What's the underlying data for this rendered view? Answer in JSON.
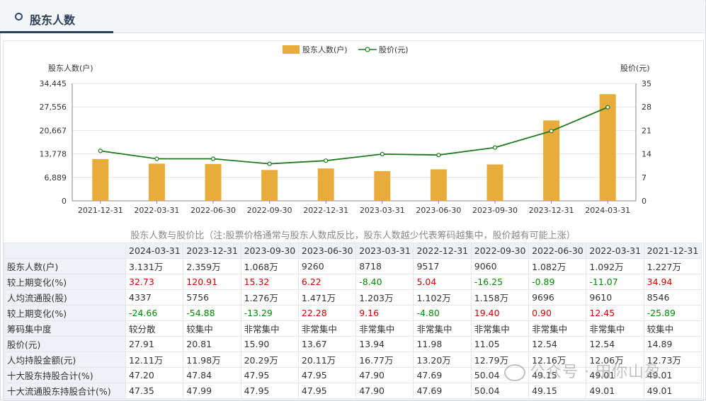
{
  "header": {
    "title": "股东人数"
  },
  "chart_data": {
    "type": "bar+line",
    "legend": [
      {
        "name": "股东人数(户)",
        "color": "#e9ac3a",
        "kind": "bar"
      },
      {
        "name": "股价(元)",
        "color": "#1e7a1e",
        "kind": "line"
      }
    ],
    "left_axis_title": "股东人数(户)",
    "right_axis_title": "股价(元)",
    "left_ticks": [
      "0",
      "6,889",
      "13,778",
      "20,667",
      "27,556",
      "34,445"
    ],
    "right_ticks": [
      "0",
      "7",
      "14",
      "21",
      "28",
      "35"
    ],
    "left_max": 34445,
    "right_max": 35,
    "categories": [
      "2021-12-31",
      "2022-03-31",
      "2022-06-30",
      "2022-09-30",
      "2022-12-31",
      "2023-03-31",
      "2023-06-30",
      "2023-09-30",
      "2023-12-31",
      "2024-03-31"
    ],
    "series": [
      {
        "name": "股东人数(户)",
        "values": [
          12270,
          10920,
          10820,
          9060,
          9517,
          8718,
          9260,
          10680,
          23590,
          31310
        ]
      },
      {
        "name": "股价(元)",
        "values": [
          14.89,
          12.54,
          12.54,
          11.05,
          11.98,
          13.94,
          13.67,
          15.9,
          20.81,
          27.91
        ]
      }
    ],
    "grid": true,
    "legend_position": "top-center"
  },
  "note": "股东人数与股价比（注:股票价格通常与股东人数成反比，股东人数越少代表筹码越集中，股价越有可能上涨）",
  "table": {
    "columns": [
      "2024-03-31",
      "2023-12-31",
      "2023-09-30",
      "2023-06-30",
      "2023-03-31",
      "2022-12-31",
      "2022-09-30",
      "2022-06-30",
      "2022-03-31",
      "2021-12-31"
    ],
    "rows": [
      {
        "label": "股东人数(户)",
        "cells": [
          "3.131万",
          "2.359万",
          "1.068万",
          "9260",
          "8718",
          "9517",
          "9060",
          "1.082万",
          "1.092万",
          "1.227万"
        ]
      },
      {
        "label": "较上期变化(%)",
        "cells": [
          "32.73",
          "120.91",
          "15.32",
          "6.22",
          "-8.40",
          "5.04",
          "-16.25",
          "-0.89",
          "-11.07",
          "34.94"
        ],
        "colored": true
      },
      {
        "label": "人均流通股(股)",
        "cells": [
          "4337",
          "5756",
          "1.276万",
          "1.471万",
          "1.203万",
          "1.102万",
          "1.158万",
          "9696",
          "9610",
          "8546"
        ]
      },
      {
        "label": "较上期变化(%)",
        "cells": [
          "-24.66",
          "-54.88",
          "-13.29",
          "22.28",
          "9.16",
          "-4.80",
          "19.40",
          "0.90",
          "12.45",
          "-25.89"
        ],
        "colored": true
      },
      {
        "label": "筹码集中度",
        "cells": [
          "较分散",
          "较集中",
          "非常集中",
          "非常集中",
          "非常集中",
          "非常集中",
          "非常集中",
          "非常集中",
          "非常集中",
          "较集中"
        ]
      },
      {
        "label": "股价(元)",
        "cells": [
          "27.91",
          "20.81",
          "15.90",
          "13.67",
          "13.94",
          "11.98",
          "11.05",
          "12.54",
          "12.54",
          "14.89"
        ]
      },
      {
        "label": "人均持股金额(元)",
        "cells": [
          "12.11万",
          "11.98万",
          "20.29万",
          "20.11万",
          "16.77万",
          "13.20万",
          "12.79万",
          "12.16万",
          "12.06万",
          "12.73万"
        ]
      },
      {
        "label": "十大股东持股合计(%)",
        "cells": [
          "47.20",
          "47.84",
          "47.95",
          "47.95",
          "47.90",
          "47.69",
          "50.04",
          "49.15",
          "49.01",
          "49.01"
        ]
      },
      {
        "label": "十大流通股东持股合计(%)",
        "cells": [
          "47.35",
          "47.99",
          "47.95",
          "47.95",
          "47.90",
          "47.69",
          "50.04",
          "49.15",
          "49.01",
          "49.01"
        ]
      }
    ]
  },
  "watermark": "公众号 · 田你山盈",
  "colors": {
    "positive": "#d40000",
    "negative": "#008c00",
    "bar": "#e9ac3a",
    "line": "#1e7a1e"
  }
}
